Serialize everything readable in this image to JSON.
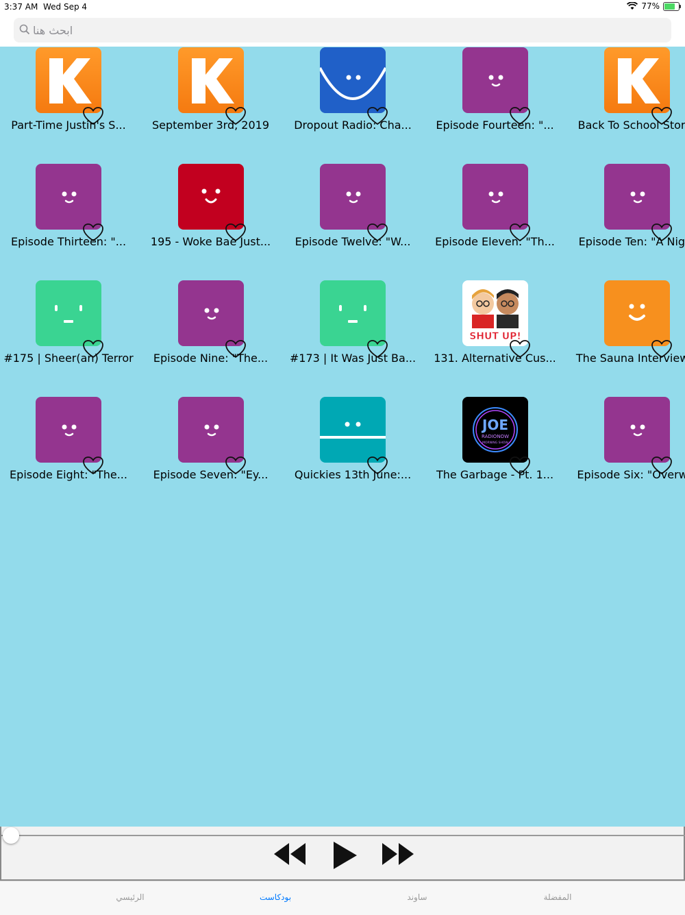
{
  "status": {
    "time": "3:37 AM",
    "date": "Wed Sep 4",
    "battery": "77%",
    "battery_level": 0.77
  },
  "search": {
    "placeholder": "ابحث هنا"
  },
  "items": [
    {
      "title": "Part-Time Justin's S...",
      "art": "kast-k"
    },
    {
      "title": "September 3rd, 2019",
      "art": "kast-k"
    },
    {
      "title": "Dropout Radio: Cha...",
      "art": "blue-smile"
    },
    {
      "title": "Episode Fourteen: \"...",
      "art": "purple-face"
    },
    {
      "title": "Back To School Story!",
      "art": "kast-k"
    },
    {
      "title": "Episode Thirteen: \"...",
      "art": "purple-face"
    },
    {
      "title": "195 - Woke Bae Just...",
      "art": "red-face"
    },
    {
      "title": "Episode Twelve: \"W...",
      "art": "purple-face"
    },
    {
      "title": "Episode Eleven: \"Th...",
      "art": "purple-face"
    },
    {
      "title": "Episode Ten: \"A Nig...",
      "art": "purple-face"
    },
    {
      "title": "#175 | Sheer(an) Terror",
      "art": "green-face"
    },
    {
      "title": "Episode Nine: \"The...",
      "art": "purple-face"
    },
    {
      "title": "#173 | It Was Just Ba...",
      "art": "green-face"
    },
    {
      "title": "131. Alternative Cus...",
      "art": "shut-up",
      "art_text": "SHUT UP!"
    },
    {
      "title": "The Sauna Interview...",
      "art": "orange-face"
    },
    {
      "title": "Episode Eight: \"The...",
      "art": "purple-face"
    },
    {
      "title": "Episode Seven: \"Ey...",
      "art": "purple-face"
    },
    {
      "title": "Quickies 13th June:...",
      "art": "teal-face"
    },
    {
      "title": "The Garbage - Pt. 1...",
      "art": "joe-radio",
      "art_text": [
        "JOE",
        "RADIONOW",
        "MORNING SHOW"
      ]
    },
    {
      "title": "Episode Six: \"Overw...",
      "art": "purple-face"
    }
  ],
  "player": {
    "progress": 0.0,
    "controls": [
      "rewind",
      "play",
      "fast-forward"
    ]
  },
  "tabs": [
    {
      "label": "الرئيسي",
      "active": false
    },
    {
      "label": "بودكاست",
      "active": true
    },
    {
      "label": "ساوند",
      "active": false
    },
    {
      "label": "المفضلة",
      "active": false
    }
  ],
  "colors": {
    "background": "#93dbeb",
    "purple": "#94358f",
    "orange": "#f7901e",
    "red": "#c2001f",
    "green": "#3ad492",
    "teal": "#00a8b4",
    "blue": "#2060c8",
    "accent": "#007aff"
  }
}
